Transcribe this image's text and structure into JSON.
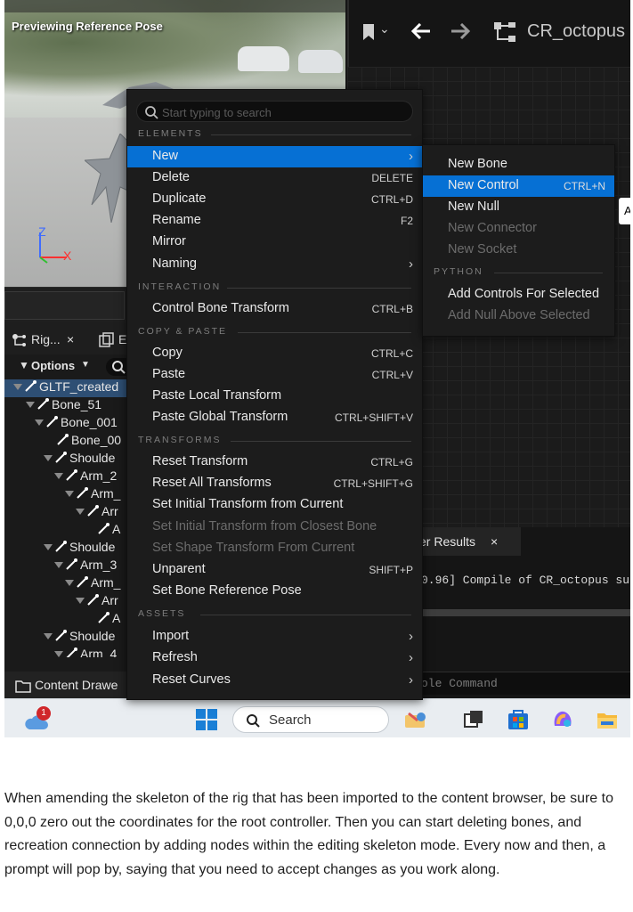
{
  "viewport": {
    "title": "Previewing Reference Pose",
    "axis_z": "Z",
    "axis_x": "X"
  },
  "toolbar": {
    "asset_title": "CR_octopus"
  },
  "rig_panel": {
    "tab_label": "Rig...",
    "tab_close": "×",
    "tab2_label": "E",
    "options_label": "Options",
    "tree": [
      {
        "label": "GLTF_created",
        "indent": 0,
        "selected": true
      },
      {
        "label": "Bone_51",
        "indent": 1
      },
      {
        "label": "Bone_001",
        "indent": 2
      },
      {
        "label": "Bone_00",
        "indent": 3
      },
      {
        "label": "Shoulde",
        "indent": 3
      },
      {
        "label": "Arm_2",
        "indent": 4
      },
      {
        "label": "Arm_",
        "indent": 5
      },
      {
        "label": "Arr",
        "indent": 6
      },
      {
        "label": "A",
        "indent": 7
      },
      {
        "label": "Shoulde",
        "indent": 3
      },
      {
        "label": "Arm_3",
        "indent": 4
      },
      {
        "label": "Arm_",
        "indent": 5
      },
      {
        "label": "Arr",
        "indent": 6
      },
      {
        "label": "A",
        "indent": 7
      },
      {
        "label": "Shoulde",
        "indent": 3
      },
      {
        "label": "Arm_4",
        "indent": 4
      }
    ]
  },
  "content_drawer": {
    "label": "Content Drawe"
  },
  "compiler": {
    "tab_label": "er Results",
    "tab_close": "×",
    "log_line": "0.96] Compile of CR_octopus su",
    "console_placeholder": "ole Command"
  },
  "context_menu": {
    "search_placeholder": "Start typing to search",
    "sections": {
      "elements": "ELEMENTS",
      "interaction": "INTERACTION",
      "copy_paste": "COPY & PASTE",
      "transforms": "TRANSFORMS",
      "assets": "ASSETS"
    },
    "items": {
      "new": {
        "label": "New",
        "arrow": "›"
      },
      "delete": {
        "label": "Delete",
        "shortcut": "DELETE"
      },
      "duplicate": {
        "label": "Duplicate",
        "shortcut": "CTRL+D"
      },
      "rename": {
        "label": "Rename",
        "shortcut": "F2"
      },
      "mirror": {
        "label": "Mirror"
      },
      "naming": {
        "label": "Naming",
        "arrow": "›"
      },
      "control_bone_transform": {
        "label": "Control Bone Transform",
        "shortcut": "CTRL+B"
      },
      "copy": {
        "label": "Copy",
        "shortcut": "CTRL+C"
      },
      "paste": {
        "label": "Paste",
        "shortcut": "CTRL+V"
      },
      "paste_local": {
        "label": "Paste Local Transform"
      },
      "paste_global": {
        "label": "Paste Global Transform",
        "shortcut": "CTRL+SHIFT+V"
      },
      "reset_transform": {
        "label": "Reset Transform",
        "shortcut": "CTRL+G"
      },
      "reset_all": {
        "label": "Reset All Transforms",
        "shortcut": "CTRL+SHIFT+G"
      },
      "set_initial_current": {
        "label": "Set Initial Transform from Current"
      },
      "set_initial_closest": {
        "label": "Set Initial Transform from Closest Bone"
      },
      "set_shape": {
        "label": "Set Shape Transform From Current"
      },
      "unparent": {
        "label": "Unparent",
        "shortcut": "SHIFT+P"
      },
      "set_bone_ref": {
        "label": "Set Bone Reference Pose"
      },
      "import": {
        "label": "Import",
        "arrow": "›"
      },
      "refresh": {
        "label": "Refresh",
        "arrow": "›"
      },
      "reset_curves": {
        "label": "Reset Curves",
        "arrow": "›"
      }
    }
  },
  "submenu": {
    "python_section": "PYTHON",
    "items": {
      "new_bone": {
        "label": "New Bone"
      },
      "new_control": {
        "label": "New Control",
        "shortcut": "CTRL+N"
      },
      "new_null": {
        "label": "New Null"
      },
      "new_connector": {
        "label": "New Connector"
      },
      "new_socket": {
        "label": "New Socket"
      },
      "add_controls": {
        "label": "Add Controls For Selected"
      },
      "add_null": {
        "label": "Add Null Above Selected"
      }
    },
    "edge_letter": "A"
  },
  "taskbar": {
    "notification_count": "1",
    "search_label": "Search"
  },
  "caption": "When amending the skeleton of the rig that has been imported to the content browser, be sure to 0,0,0 zero out the coordinates for the root controller. Then you can start deleting bones, and recreation connection by adding nodes within the editing skeleton mode. Every now and then, a prompt will pop by, saying that you need to accept changes as you work along.",
  "colors": {
    "highlight": "#0670d4",
    "menu_bg": "#1c1c1c",
    "selected_row": "#2e4f74"
  }
}
